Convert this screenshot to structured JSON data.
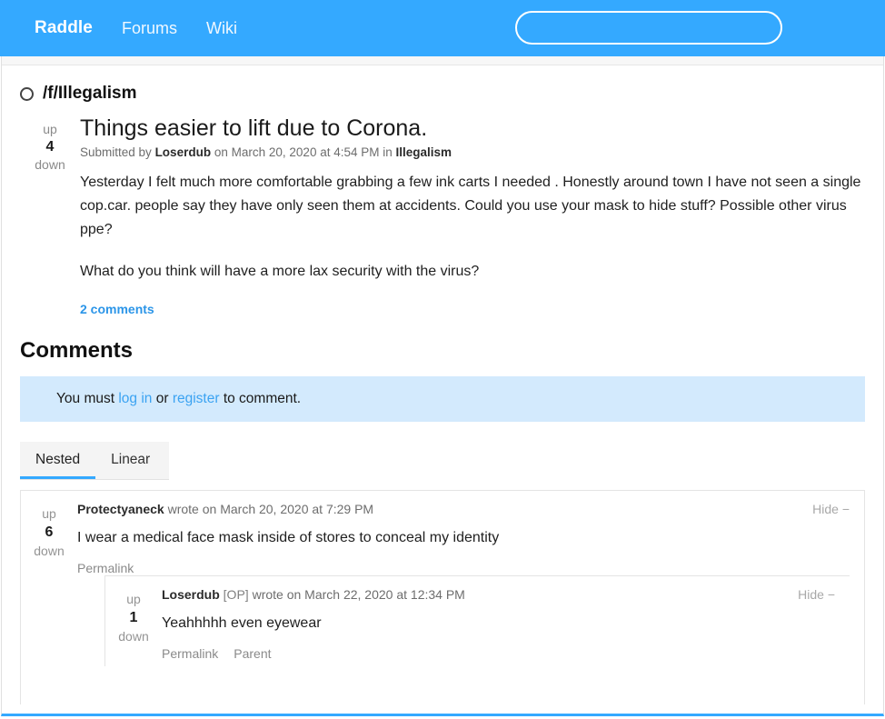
{
  "navbar": {
    "brand": "Raddle",
    "links": [
      {
        "label": "Forums"
      },
      {
        "label": "Wiki"
      }
    ],
    "search": {
      "value": "",
      "placeholder": ""
    },
    "background_color": "#34a9ff"
  },
  "forum": {
    "name": "/f/Illegalism"
  },
  "submission": {
    "vote_up_label": "up",
    "vote_down_label": "down",
    "score": "4",
    "title": "Things easier to lift due to Corona.",
    "meta": {
      "submitted_prefix": "Submitted by",
      "author": "Loserdub",
      "on": "on",
      "datetime": "March 20, 2020 at 4:54 PM",
      "in": "in",
      "forum": "Illegalism"
    },
    "body": [
      "Yesterday I felt much more comfortable grabbing a few ink carts I needed . Honestly around town I have not seen a single cop.car. people say they have only seen them at accidents. Could you use your mask to hide stuff? Possible other virus ppe?",
      "What do you think will have a more lax security with the virus?"
    ],
    "comments_link": "2 comments"
  },
  "comments_section": {
    "heading": "Comments",
    "notice": {
      "prefix": "You must ",
      "login_label": "log in",
      "middle": " or ",
      "register_label": "register",
      "suffix": " to comment."
    },
    "tabs": [
      {
        "label": "Nested",
        "active": true
      },
      {
        "label": "Linear",
        "active": false
      }
    ],
    "items": [
      {
        "vote_up_label": "up",
        "vote_down_label": "down",
        "score": "6",
        "author": "Protectyaneck",
        "op_tag": "",
        "wrote": "wrote on",
        "datetime": "March 20, 2020 at 7:29 PM",
        "hide_label": "Hide −",
        "body": "I wear a medical face mask inside of stores to conceal my identity",
        "actions": [
          "Permalink"
        ]
      },
      {
        "vote_up_label": "up",
        "vote_down_label": "down",
        "score": "1",
        "author": "Loserdub",
        "op_tag": "[OP]",
        "wrote": "wrote on",
        "datetime": "March 22, 2020 at 12:34 PM",
        "hide_label": "Hide −",
        "body": "Yeahhhhh even eyewear",
        "actions": [
          "Permalink",
          "Parent"
        ]
      }
    ]
  },
  "theme": {
    "accent": "#34a9ff",
    "link": "#2b95e8",
    "notice_bg": "#d3eafd"
  }
}
